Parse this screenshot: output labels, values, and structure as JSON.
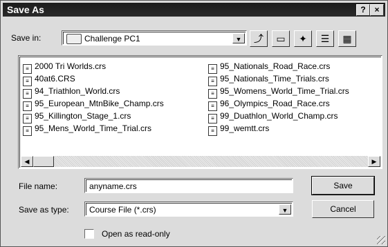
{
  "window": {
    "title": "Save As",
    "help_btn": "?",
    "close_btn": "×"
  },
  "save_in": {
    "label": "Save in:",
    "value": "Challenge PC1"
  },
  "toolbar": {
    "up": "up-folder-icon",
    "desktop": "desktop-icon",
    "new_folder": "new-folder-icon",
    "list_view": "list-view-icon",
    "details_view": "details-view-icon"
  },
  "files": {
    "col1": [
      "2000 Tri Worlds.crs",
      "40at6.CRS",
      "94_Triathlon_World.crs",
      "95_European_MtnBike_Champ.crs",
      "95_Killington_Stage_1.crs",
      "95_Mens_World_Time_Trial.crs"
    ],
    "col2": [
      "95_Nationals_Road_Race.crs",
      "95_Nationals_Time_Trials.crs",
      "95_Womens_World_Time_Trial.crs",
      "96_Olympics_Road_Race.crs",
      "99_Duathlon_World_Champ.crs",
      "99_wemtt.crs"
    ]
  },
  "file_name": {
    "label": "File name:",
    "value": "anyname.crs"
  },
  "save_as_type": {
    "label": "Save as type:",
    "value": "Course File (*.crs)"
  },
  "buttons": {
    "save": "Save",
    "cancel": "Cancel"
  },
  "read_only": {
    "label": "Open as read-only"
  }
}
